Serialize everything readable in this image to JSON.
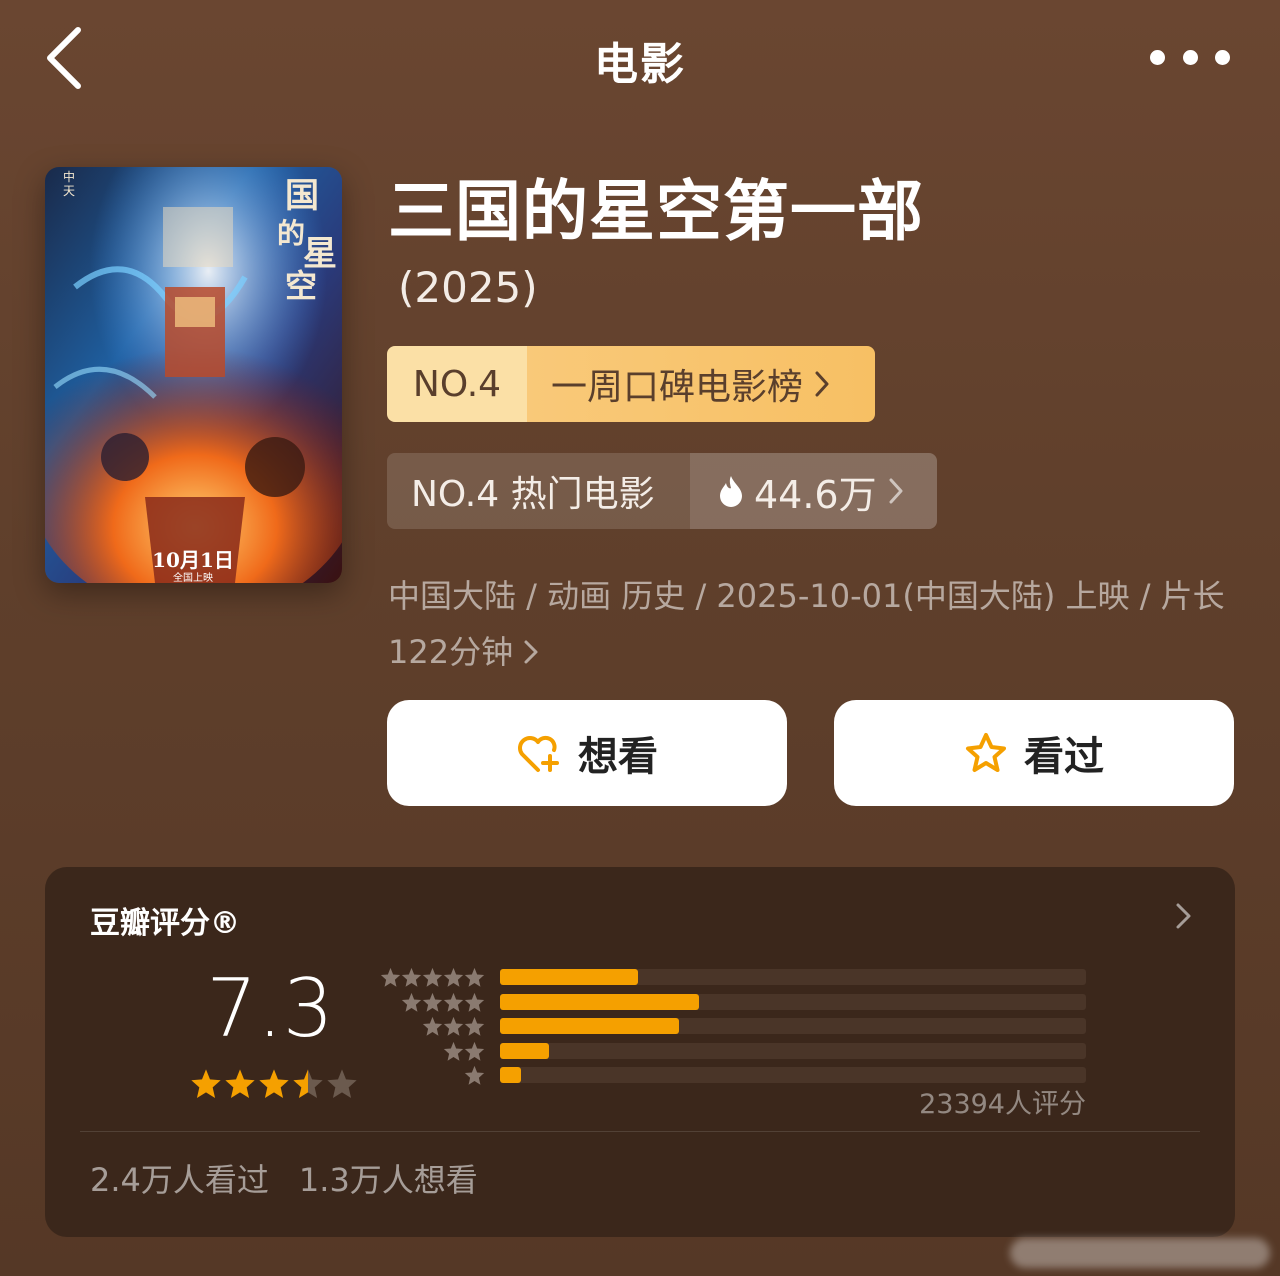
{
  "header": {
    "title": "电影"
  },
  "movie": {
    "title": "三国的星空第一部",
    "year": "(2025)",
    "poster": {
      "release_date": "10月1日",
      "release_note": "全国上映"
    }
  },
  "rank_week": {
    "number": "NO.4",
    "label": "一周口碑电影榜"
  },
  "rank_hot": {
    "label": "NO.4 热门电影",
    "heat": "44.6万"
  },
  "meta": {
    "line1": "中国大陆 / 动画 历史 / 2025-10-01(中国大陆) 上映 / 片长",
    "line2": "122分钟"
  },
  "actions": {
    "want": "想看",
    "watched": "看过"
  },
  "rating": {
    "title": "豆瓣评分®",
    "score": "7.3",
    "score_stars": 3.5,
    "raters": "23394人评分",
    "distribution": [
      {
        "stars": 5,
        "fraction": 0.235
      },
      {
        "stars": 4,
        "fraction": 0.34
      },
      {
        "stars": 3,
        "fraction": 0.305
      },
      {
        "stars": 2,
        "fraction": 0.083
      },
      {
        "stars": 1,
        "fraction": 0.035
      }
    ],
    "watched": "2.4万人看过",
    "wanted": "1.3万人想看"
  },
  "colors": {
    "accent": "#f5a000",
    "badge_gold": "#f7c064",
    "background": "#5f3f2b",
    "card": "#3b271b"
  }
}
